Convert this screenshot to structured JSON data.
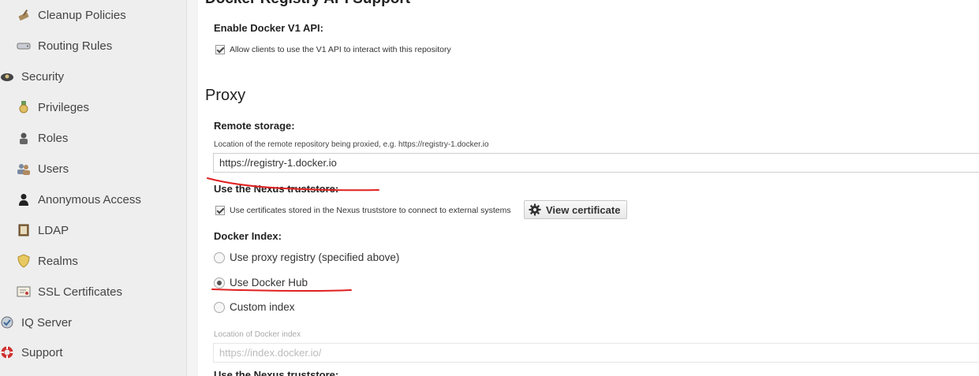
{
  "sidebar": {
    "items": [
      {
        "label": "Cleanup Policies",
        "icon": "broom-icon"
      },
      {
        "label": "Routing Rules",
        "icon": "drive-icon"
      },
      {
        "label": "Security",
        "icon": "security-icon"
      },
      {
        "label": "Privileges",
        "icon": "medal-icon"
      },
      {
        "label": "Roles",
        "icon": "role-icon"
      },
      {
        "label": "Users",
        "icon": "users-icon"
      },
      {
        "label": "Anonymous Access",
        "icon": "user-icon"
      },
      {
        "label": "LDAP",
        "icon": "book-icon"
      },
      {
        "label": "Realms",
        "icon": "shield-icon"
      },
      {
        "label": "SSL Certificates",
        "icon": "certificate-icon"
      },
      {
        "label": "IQ Server",
        "icon": "iq-server-icon"
      },
      {
        "label": "Support",
        "icon": "lifebuoy-icon"
      }
    ]
  },
  "docker_api": {
    "section_title": "Docker Registry API Support",
    "v1_label": "Enable Docker V1 API:",
    "v1_checkbox_label": "Allow clients to use the V1 API to interact with this repository",
    "v1_checked": true
  },
  "proxy": {
    "section_title": "Proxy",
    "remote_label": "Remote storage:",
    "remote_help": "Location of the remote repository being proxied, e.g. https://registry-1.docker.io",
    "remote_value": "https://registry-1.docker.io",
    "truststore_label": "Use the Nexus truststore:",
    "truststore_checkbox_label": "Use certificates stored in the Nexus truststore to connect to external systems",
    "truststore_checked": true,
    "view_certificate_label": "View certificate",
    "docker_index_label": "Docker Index:",
    "index_options": [
      {
        "label": "Use proxy registry (specified above)",
        "selected": false
      },
      {
        "label": "Use Docker Hub",
        "selected": true
      },
      {
        "label": "Custom index",
        "selected": false
      }
    ],
    "index_location_help": "Location of Docker index",
    "index_location_placeholder": "https://index.docker.io/",
    "truststore_label_2": "Use the Nexus truststore:"
  },
  "colors": {
    "sidebar_bg": "#eeeeee",
    "annotation_red": "#e02020"
  }
}
